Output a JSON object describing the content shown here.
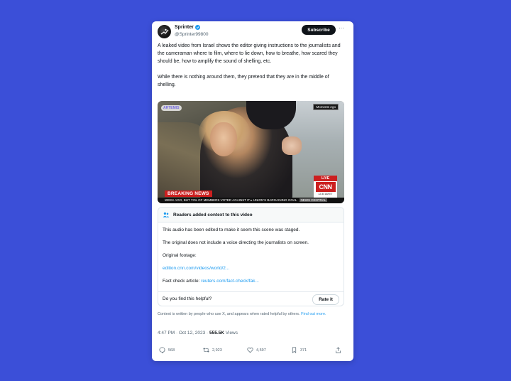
{
  "author": {
    "name": "Sprinter",
    "handle": "@Sprinter99800",
    "subscribe_label": "Subscribe",
    "more_label": "···",
    "verified_color": "#1d9bf0"
  },
  "tweet": {
    "paragraph1": "A leaked video from Israel shows the editor giving instructions to the journalists and the cameraman where to film, where to lie down, how to breathe, how scared they should be, how to amplify the sound of shelling, etc.",
    "paragraph2": "While there is nothing around them, they pretend that they are in the middle of shelling."
  },
  "media": {
    "watermark": "ARTEMIS",
    "moments_label": "Moments Ago",
    "breaking_label": "BREAKING NEWS",
    "ticker": "WEEK AGO, BUT 73% OF MEMBERS VOTED AGAINST IT  ▸ UNION'S BARGAINING GOAL",
    "ticker_tag": "NEWS CENTRAL",
    "live_label": "LIVE",
    "network_logo": "CNN",
    "network_time": "12:34 AM ET"
  },
  "context": {
    "header": "Readers added context to this video",
    "line1": "This audio has been edited to make it seem this scene was staged.",
    "line2": "The original does not include a voice directing the journalists on screen.",
    "line3": "Original footage:",
    "link1": "edition.cnn.com/videos/world/2...",
    "line4_prefix": "Fact check article:",
    "link2": "reuters.com/fact-check/fak...",
    "helpful_question": "Do you find this helpful?",
    "rate_label": "Rate it"
  },
  "disclaimer": {
    "text": "Context is written by people who use X, and appears when rated helpful by others.",
    "link": "Find out more."
  },
  "meta": {
    "time": "4:47 PM · Oct 12, 2023 ·",
    "views": "555.5K",
    "views_label": "Views"
  },
  "actions": {
    "replies": "568",
    "reposts": "2,923",
    "likes": "4,597",
    "bookmarks": "371"
  },
  "colors": {
    "background": "#3b4fd8",
    "link": "#1d9bf0",
    "breaking": "#cc1f1f"
  }
}
